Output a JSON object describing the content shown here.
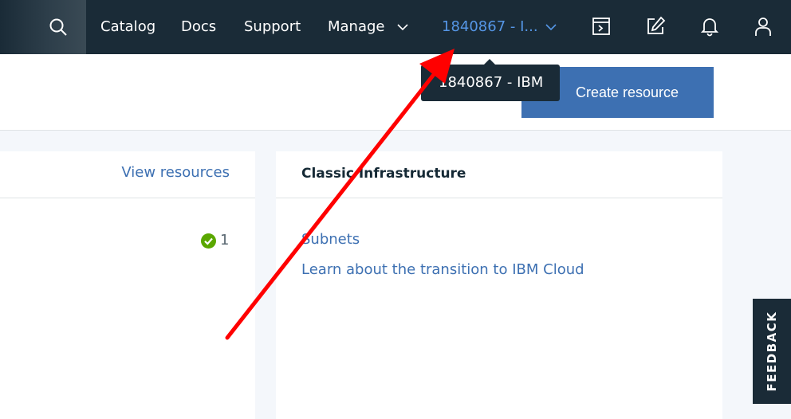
{
  "nav": {
    "catalog": "Catalog",
    "docs": "Docs",
    "support": "Support",
    "manage": "Manage",
    "account": "1840867 - I...",
    "icons": [
      "search-icon",
      "terminal-icon",
      "edit-icon",
      "bell-icon",
      "user-icon"
    ]
  },
  "tooltip": {
    "text": "1840867 - IBM"
  },
  "header": {
    "create_button": "Create resource"
  },
  "resources_card": {
    "view_link": "View resources",
    "status_count": "1"
  },
  "classic_card": {
    "title": "Classic Infrastructure",
    "links": [
      "Subnets",
      "Learn about the transition to IBM Cloud"
    ]
  },
  "feedback": {
    "label": "FEEDBACK"
  },
  "colors": {
    "nav_bg": "#1a2b37",
    "link": "#3d70b2",
    "account_link": "#5596e6",
    "button": "#3d70b2",
    "success": "#5aa700",
    "arrow": "#ff0000"
  }
}
